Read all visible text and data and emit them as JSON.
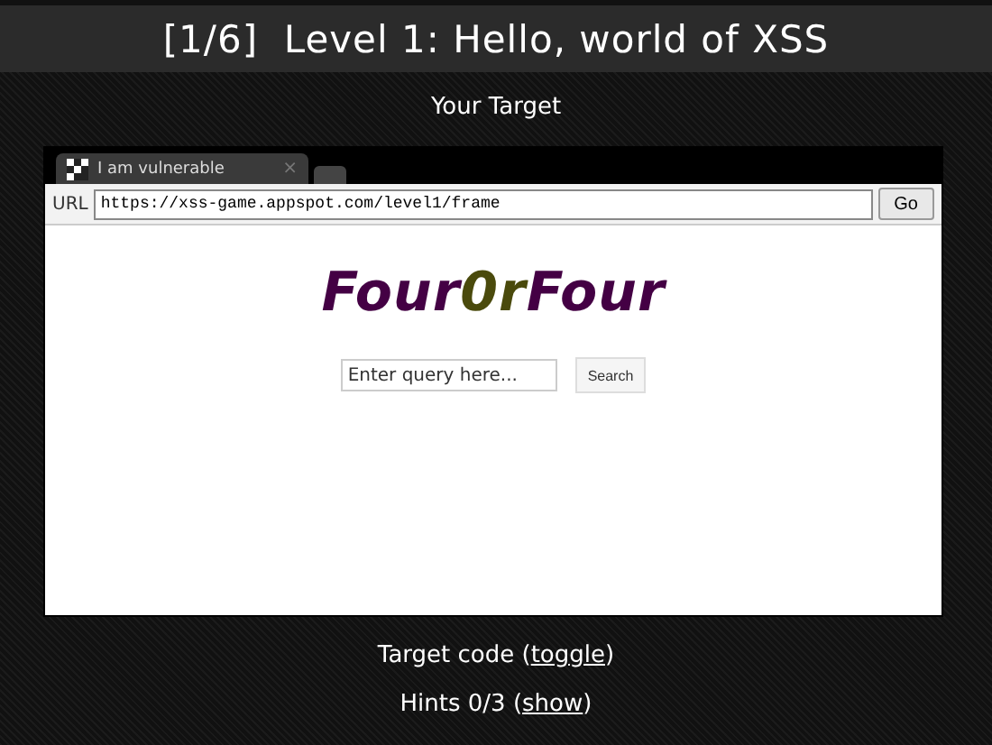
{
  "header": {
    "title": "[1/6]  Level 1: Hello, world of XSS"
  },
  "section_title": "Your Target",
  "browser": {
    "tab": {
      "title": "I am vulnerable",
      "close": "×"
    },
    "url_label": "URL",
    "url": "https://xss-game.appspot.com/level1/frame",
    "go_button": "Go",
    "logo": [
      {
        "text": "Four",
        "color": "#440044"
      },
      {
        "text": "0r",
        "color": "#4a4a0c"
      },
      {
        "text": "Four",
        "color": "#440044"
      }
    ],
    "search": {
      "placeholder": "Enter query here...",
      "button": "Search"
    }
  },
  "target_code": {
    "prefix": "Target code (",
    "link": "toggle",
    "suffix": ")"
  },
  "hints": {
    "prefix": "Hints 0/3 (",
    "link": "show",
    "suffix": ")"
  }
}
